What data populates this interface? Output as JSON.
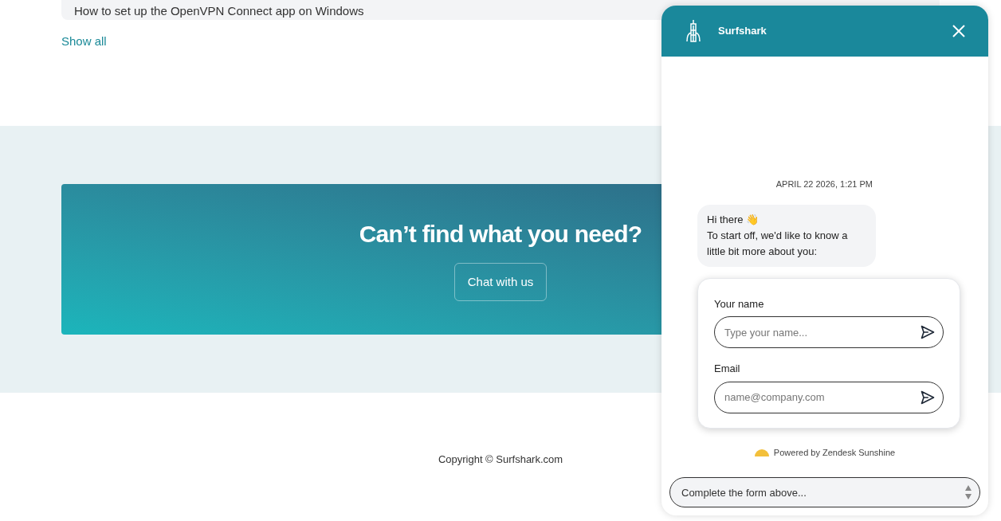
{
  "article_row": {
    "title": "How to set up the OpenVPN Connect app on Windows"
  },
  "show_all": "Show all",
  "banner": {
    "heading": "Can’t find what you need?",
    "button": "Chat with us"
  },
  "footer": {
    "copyright": "Copyright © Surfshark.com"
  },
  "chat": {
    "title": "Surfshark",
    "timestamp": "APRIL 22 2026, 1:21 PM",
    "message_lines": [
      "Hi there 👋",
      "To start off, we'd like to know a little bit more about you:"
    ],
    "form": [
      {
        "label": "Your name",
        "placeholder": "Type your name..."
      },
      {
        "label": "Email",
        "placeholder": "name@company.com"
      }
    ],
    "powered_by": "Powered by Zendesk Sunshine",
    "composer": {
      "placeholder": "Complete the form above..."
    }
  }
}
